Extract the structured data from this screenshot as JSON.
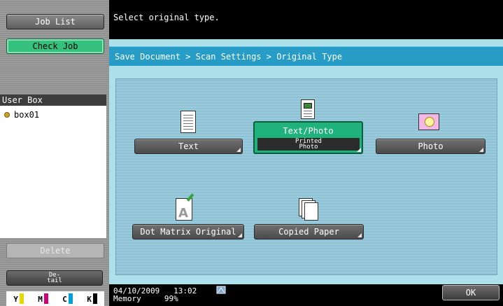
{
  "sidebar": {
    "job_list": "Job List",
    "check_job": "Check Job",
    "user_box_header": "User Box",
    "user_box_item": "box01",
    "delete": "Delete",
    "detail_line1": "De-",
    "detail_line2": "tail",
    "toner": [
      {
        "label": "Y",
        "color": "#e6d800"
      },
      {
        "label": "M",
        "color": "#d4007a"
      },
      {
        "label": "C",
        "color": "#00a0d8"
      },
      {
        "label": "K",
        "color": "#000000"
      }
    ]
  },
  "message": "Select original type.",
  "breadcrumb": "Save Document > Scan Settings > Original Type",
  "options": {
    "text": "Text",
    "text_photo": "Text/Photo",
    "text_photo_sub1": "Printed",
    "text_photo_sub2": "Photo",
    "photo": "Photo",
    "dot_matrix": "Dot Matrix Original",
    "copied_paper": "Copied Paper"
  },
  "selected_option": "Text/Photo",
  "status": {
    "date": "04/10/2009",
    "time": "13:02",
    "memory_label": "Memory",
    "memory_value": "99%"
  },
  "ok": "OK",
  "icons": [
    "text-document-icon",
    "text-photo-document-icon",
    "photo-icon",
    "dot-matrix-icon",
    "copied-paper-icon",
    "network-icon",
    "user-box-icon"
  ]
}
